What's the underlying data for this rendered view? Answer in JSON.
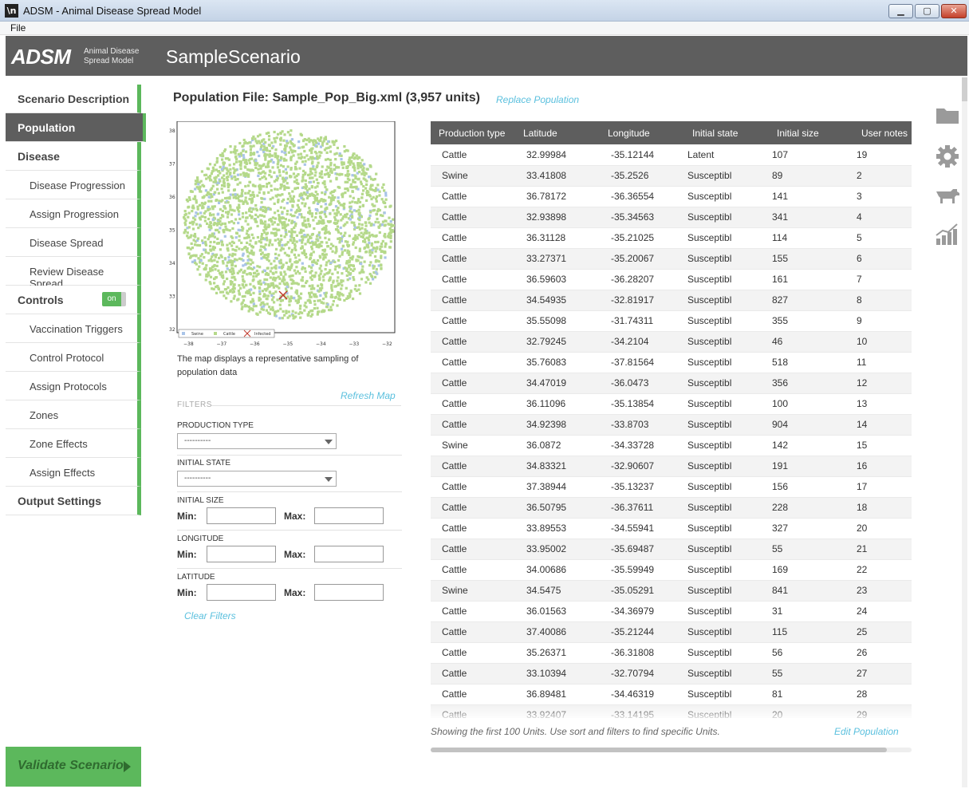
{
  "window": {
    "title": "ADSM - Animal Disease Spread Model",
    "min": "▁",
    "max": "▢",
    "close": "✕"
  },
  "menu": {
    "file": "File"
  },
  "header": {
    "logo": "ADSM",
    "logo_sub_1": "Animal Disease",
    "logo_sub_2": "Spread Model",
    "scenario_name": "SampleScenario"
  },
  "sidebar": {
    "items": [
      {
        "label": "Scenario Description"
      },
      {
        "label": "Population"
      },
      {
        "label": "Disease"
      },
      {
        "label": "Disease Progression"
      },
      {
        "label": "Assign Progression"
      },
      {
        "label": "Disease Spread"
      },
      {
        "label": "Review Disease Spread"
      },
      {
        "label": "Controls"
      },
      {
        "label": "Vaccination Triggers"
      },
      {
        "label": "Control Protocol"
      },
      {
        "label": "Assign Protocols"
      },
      {
        "label": "Zones"
      },
      {
        "label": "Zone Effects"
      },
      {
        "label": "Assign Effects"
      },
      {
        "label": "Output Settings"
      }
    ],
    "controls_toggle": "on",
    "validate": "Validate Scenario"
  },
  "main": {
    "title": "Population File: Sample_Pop_Big.xml (3,957 units)",
    "replace_link": "Replace Population",
    "map_caption": "The map displays a representative sampling of population data",
    "refresh_link": "Refresh Map",
    "map": {
      "y_ticks": [
        "38",
        "37",
        "36",
        "35",
        "34",
        "33",
        "32"
      ],
      "x_ticks": [
        "−38",
        "−37",
        "−36",
        "−35",
        "−34",
        "−33",
        "−32"
      ],
      "legend": {
        "swine": "Swine",
        "cattle": "Cattle",
        "infected": "Infected"
      },
      "colors": {
        "swine": "#a9c4e8",
        "cattle": "#b5d98a",
        "infected": "#d9534f"
      }
    },
    "filters": {
      "title": "FILTERS",
      "production_type": {
        "label": "PRODUCTION TYPE",
        "value": "----------"
      },
      "initial_state": {
        "label": "INITIAL STATE",
        "value": "----------"
      },
      "initial_size": {
        "label": "INITIAL SIZE"
      },
      "longitude": {
        "label": "LONGITUDE"
      },
      "latitude": {
        "label": "LATITUDE"
      },
      "min_label": "Min:",
      "max_label": "Max:",
      "clear_link": "Clear Filters"
    }
  },
  "table": {
    "columns": [
      "Production type",
      "Latitude",
      "Longitude",
      "Initial state",
      "Initial size",
      "User notes"
    ],
    "rows": [
      [
        "Cattle",
        "32.99984",
        "-35.12144",
        "Latent",
        "107",
        "19"
      ],
      [
        "Swine",
        "33.41808",
        "-35.2526",
        "Susceptibl",
        "89",
        "2"
      ],
      [
        "Cattle",
        "36.78172",
        "-36.36554",
        "Susceptibl",
        "141",
        "3"
      ],
      [
        "Cattle",
        "32.93898",
        "-35.34563",
        "Susceptibl",
        "341",
        "4"
      ],
      [
        "Cattle",
        "36.31128",
        "-35.21025",
        "Susceptibl",
        "114",
        "5"
      ],
      [
        "Cattle",
        "33.27371",
        "-35.20067",
        "Susceptibl",
        "155",
        "6"
      ],
      [
        "Cattle",
        "36.59603",
        "-36.28207",
        "Susceptibl",
        "161",
        "7"
      ],
      [
        "Cattle",
        "34.54935",
        "-32.81917",
        "Susceptibl",
        "827",
        "8"
      ],
      [
        "Cattle",
        "35.55098",
        "-31.74311",
        "Susceptibl",
        "355",
        "9"
      ],
      [
        "Cattle",
        "32.79245",
        "-34.2104",
        "Susceptibl",
        "46",
        "10"
      ],
      [
        "Cattle",
        "35.76083",
        "-37.81564",
        "Susceptibl",
        "518",
        "11"
      ],
      [
        "Cattle",
        "34.47019",
        "-36.0473",
        "Susceptibl",
        "356",
        "12"
      ],
      [
        "Cattle",
        "36.11096",
        "-35.13854",
        "Susceptibl",
        "100",
        "13"
      ],
      [
        "Cattle",
        "34.92398",
        "-33.8703",
        "Susceptibl",
        "904",
        "14"
      ],
      [
        "Swine",
        "36.0872",
        "-34.33728",
        "Susceptibl",
        "142",
        "15"
      ],
      [
        "Cattle",
        "34.83321",
        "-32.90607",
        "Susceptibl",
        "191",
        "16"
      ],
      [
        "Cattle",
        "37.38944",
        "-35.13237",
        "Susceptibl",
        "156",
        "17"
      ],
      [
        "Cattle",
        "36.50795",
        "-36.37611",
        "Susceptibl",
        "228",
        "18"
      ],
      [
        "Cattle",
        "33.89553",
        "-34.55941",
        "Susceptibl",
        "327",
        "20"
      ],
      [
        "Cattle",
        "33.95002",
        "-35.69487",
        "Susceptibl",
        "55",
        "21"
      ],
      [
        "Cattle",
        "34.00686",
        "-35.59949",
        "Susceptibl",
        "169",
        "22"
      ],
      [
        "Swine",
        "34.5475",
        "-35.05291",
        "Susceptibl",
        "841",
        "23"
      ],
      [
        "Cattle",
        "36.01563",
        "-34.36979",
        "Susceptibl",
        "31",
        "24"
      ],
      [
        "Cattle",
        "37.40086",
        "-35.21244",
        "Susceptibl",
        "115",
        "25"
      ],
      [
        "Cattle",
        "35.26371",
        "-36.31808",
        "Susceptibl",
        "56",
        "26"
      ],
      [
        "Cattle",
        "33.10394",
        "-32.70794",
        "Susceptibl",
        "55",
        "27"
      ],
      [
        "Cattle",
        "36.89481",
        "-34.46319",
        "Susceptibl",
        "81",
        "28"
      ],
      [
        "Cattle",
        "33.92407",
        "-33.14195",
        "Susceptibl",
        "20",
        "29"
      ]
    ],
    "showing": "Showing the first 100 Units. Use sort and filters to find specific Units.",
    "edit_link": "Edit Population"
  },
  "right_icons": [
    "folder-icon",
    "gear-icon",
    "cow-icon",
    "chart-icon"
  ]
}
